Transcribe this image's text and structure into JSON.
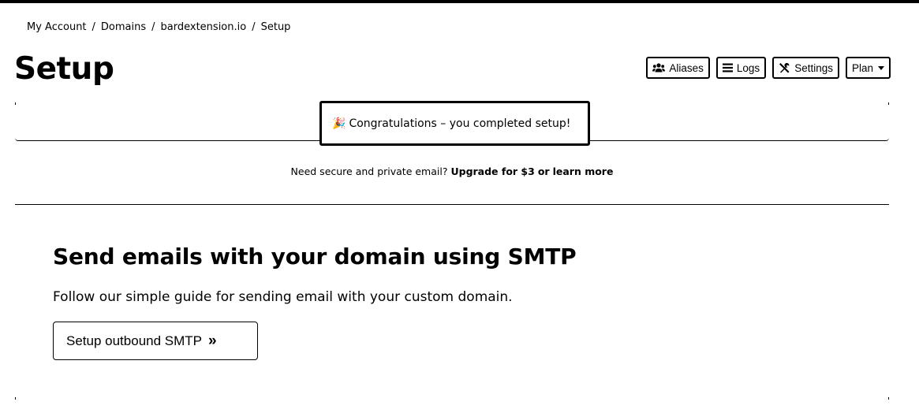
{
  "breadcrumb": [
    "My Account",
    "Domains",
    "bardextension.io",
    "Setup"
  ],
  "page": {
    "title": "Setup"
  },
  "toolbar": {
    "aliases": {
      "label": "Aliases",
      "icon": "users-icon"
    },
    "logs": {
      "label": "Logs",
      "icon": "list-icon"
    },
    "settings": {
      "label": "Settings",
      "icon": "tools-icon"
    },
    "plan": {
      "label": "Plan",
      "icon": "chevron-down-icon"
    }
  },
  "alert": {
    "icon": "party-popper-icon",
    "glyph": "🎉",
    "text": "Congratulations – you completed setup!"
  },
  "upsell": {
    "prefix": "Need secure and private email?",
    "upgrade": "Upgrade for $3",
    "or": "or",
    "learn": "learn more"
  },
  "smtp": {
    "title": "Send emails with your domain using SMTP",
    "description": "Follow our simple guide for sending email with your custom domain.",
    "button_label": "Setup outbound SMTP",
    "button_icon": "double-chevron-right-icon",
    "button_glyph": "»"
  }
}
